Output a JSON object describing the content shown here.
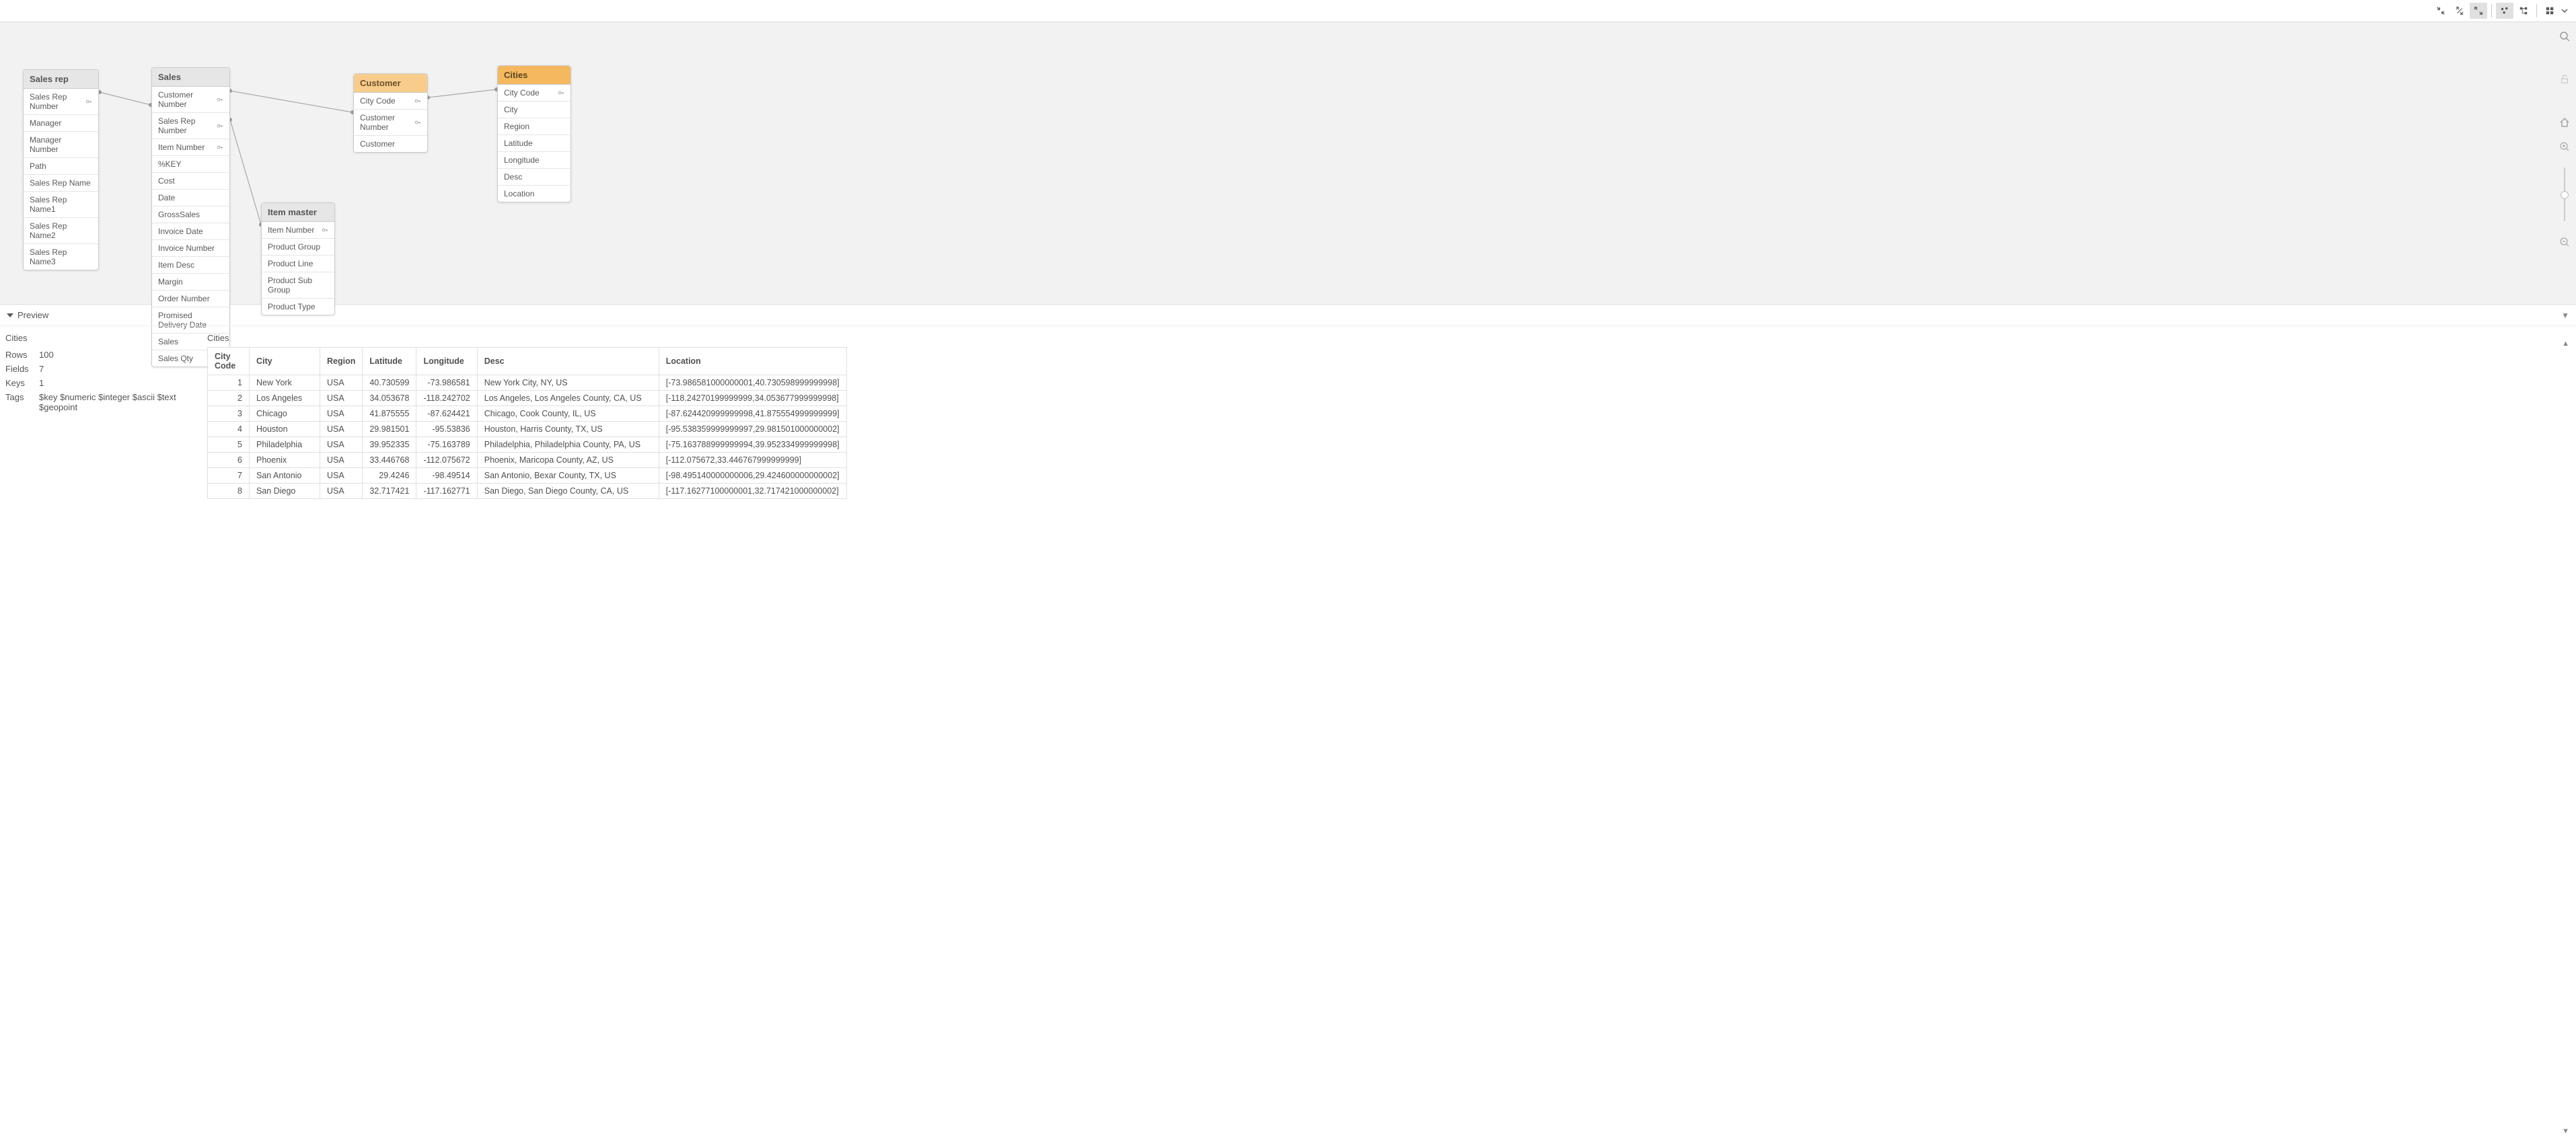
{
  "toolbar": {
    "icons": [
      "collapse-in",
      "collapse-alt",
      "expand-out",
      "scatter-view",
      "tree-view",
      "grid-view",
      "dropdown"
    ]
  },
  "tables": {
    "salesrep": {
      "title": "Sales rep",
      "fields": [
        {
          "name": "Sales Rep Number",
          "key": true
        },
        {
          "name": "Manager"
        },
        {
          "name": "Manager Number"
        },
        {
          "name": "Path"
        },
        {
          "name": "Sales Rep Name"
        },
        {
          "name": "Sales Rep Name1"
        },
        {
          "name": "Sales Rep Name2"
        },
        {
          "name": "Sales Rep Name3"
        }
      ]
    },
    "sales": {
      "title": "Sales",
      "fields": [
        {
          "name": "Customer Number",
          "key": true
        },
        {
          "name": "Sales Rep Number",
          "key": true
        },
        {
          "name": "Item Number",
          "key": true
        },
        {
          "name": "%KEY"
        },
        {
          "name": "Cost"
        },
        {
          "name": "Date"
        },
        {
          "name": "GrossSales"
        },
        {
          "name": "Invoice Date"
        },
        {
          "name": "Invoice Number"
        },
        {
          "name": "Item Desc"
        },
        {
          "name": "Margin"
        },
        {
          "name": "Order Number"
        },
        {
          "name": "Promised Delivery Date"
        },
        {
          "name": "Sales"
        },
        {
          "name": "Sales Qty"
        }
      ]
    },
    "customer": {
      "title": "Customer",
      "fields": [
        {
          "name": "City Code",
          "key": true
        },
        {
          "name": "Customer Number",
          "key": true
        },
        {
          "name": "Customer"
        }
      ]
    },
    "cities": {
      "title": "Cities",
      "fields": [
        {
          "name": "City Code",
          "key": true
        },
        {
          "name": "City"
        },
        {
          "name": "Region"
        },
        {
          "name": "Latitude"
        },
        {
          "name": "Longitude"
        },
        {
          "name": "Desc"
        },
        {
          "name": "Location"
        }
      ]
    },
    "itemmaster": {
      "title": "Item master",
      "fields": [
        {
          "name": "Item Number",
          "key": true
        },
        {
          "name": "Product Group"
        },
        {
          "name": "Product Line"
        },
        {
          "name": "Product Sub Group"
        },
        {
          "name": "Product Type"
        }
      ]
    }
  },
  "preview": {
    "label": "Preview",
    "meta": {
      "title": "Cities",
      "rows_label": "Rows",
      "rows": "100",
      "fields_label": "Fields",
      "fields": "7",
      "keys_label": "Keys",
      "keys": "1",
      "tags_label": "Tags",
      "tags": "$key $numeric $integer $ascii $text $geopoint"
    },
    "data": {
      "title": "Cities",
      "headers": [
        "City Code",
        "City",
        "Region",
        "Latitude",
        "Longitude",
        "Desc",
        "Location"
      ],
      "rows": [
        {
          "code": "1",
          "city": "New York",
          "region": "USA",
          "lat": "40.730599",
          "lon": "-73.986581",
          "desc": "New York City, NY, US",
          "loc": "[-73.986581000000001,40.730598999999998]"
        },
        {
          "code": "2",
          "city": "Los Angeles",
          "region": "USA",
          "lat": "34.053678",
          "lon": "-118.242702",
          "desc": "Los Angeles, Los Angeles County, CA, US",
          "loc": "[-118.24270199999999,34.053677999999998]"
        },
        {
          "code": "3",
          "city": "Chicago",
          "region": "USA",
          "lat": "41.875555",
          "lon": "-87.624421",
          "desc": "Chicago, Cook County, IL, US",
          "loc": "[-87.624420999999998,41.875554999999999]"
        },
        {
          "code": "4",
          "city": "Houston",
          "region": "USA",
          "lat": "29.981501",
          "lon": "-95.53836",
          "desc": "Houston, Harris County, TX, US",
          "loc": "[-95.538359999999997,29.981501000000002]"
        },
        {
          "code": "5",
          "city": "Philadelphia",
          "region": "USA",
          "lat": "39.952335",
          "lon": "-75.163789",
          "desc": "Philadelphia, Philadelphia County, PA, US",
          "loc": "[-75.163788999999994,39.952334999999998]"
        },
        {
          "code": "6",
          "city": "Phoenix",
          "region": "USA",
          "lat": "33.446768",
          "lon": "-112.075672",
          "desc": "Phoenix, Maricopa County, AZ, US",
          "loc": "[-112.075672,33.446767999999999]"
        },
        {
          "code": "7",
          "city": "San Antonio",
          "region": "USA",
          "lat": "29.4246",
          "lon": "-98.49514",
          "desc": "San Antonio, Bexar County, TX, US",
          "loc": "[-98.495140000000006,29.424600000000002]"
        },
        {
          "code": "8",
          "city": "San Diego",
          "region": "USA",
          "lat": "32.717421",
          "lon": "-117.162771",
          "desc": "San Diego, San Diego County, CA, US",
          "loc": "[-117.16277100000001,32.717421000000002]"
        }
      ]
    }
  }
}
